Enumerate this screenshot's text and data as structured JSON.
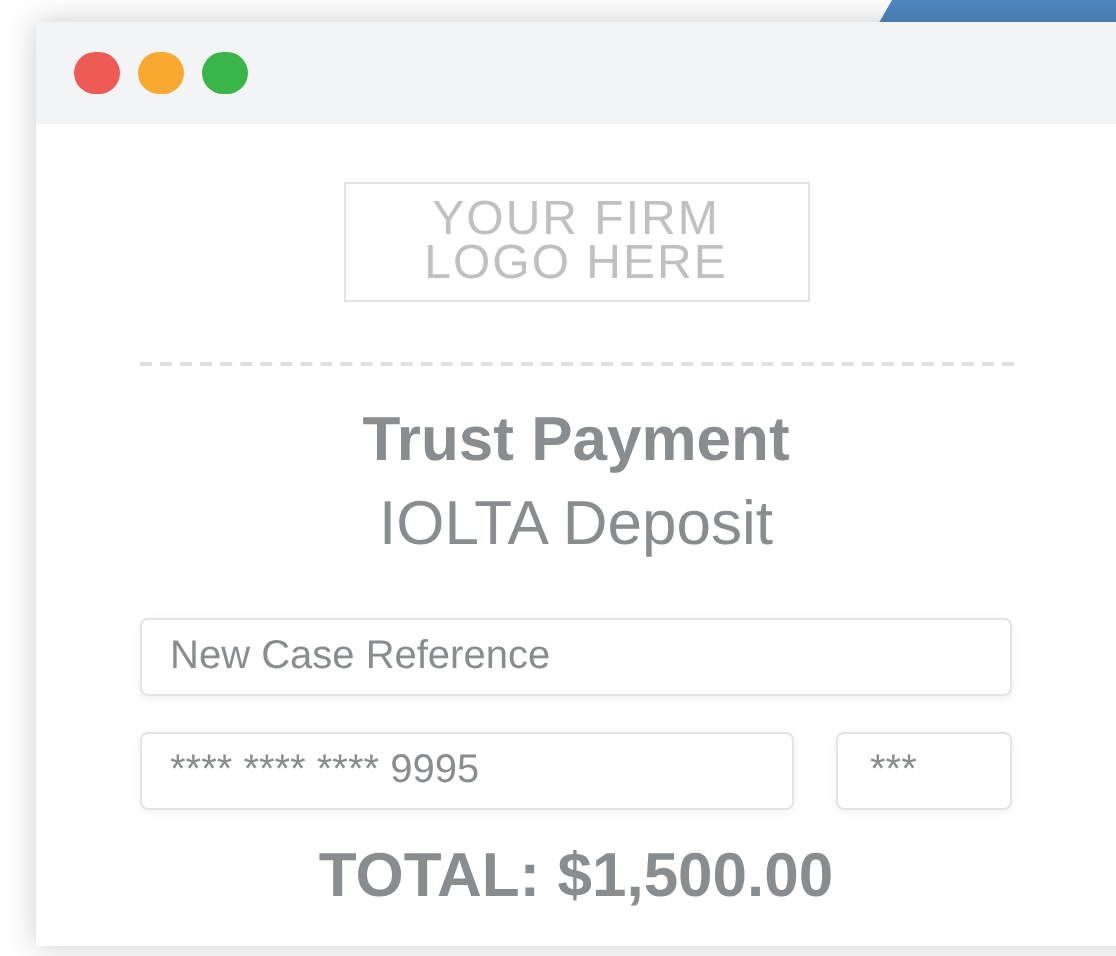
{
  "window": {
    "controls": [
      {
        "color": "#ee5a55"
      },
      {
        "color": "#f9a92f"
      },
      {
        "color": "#39b54a"
      }
    ]
  },
  "logo": {
    "text": [
      "YOUR FIRM",
      "LOGO HERE"
    ]
  },
  "title": "Trust Payment",
  "subtitle": "IOLTA Deposit",
  "fields": {
    "case_reference": {
      "placeholder": "New Case Reference"
    },
    "card_number": {
      "value": "**** **** **** 9995"
    },
    "cvv": {
      "value": "***"
    }
  },
  "total": "TOTAL: $1,500.00"
}
